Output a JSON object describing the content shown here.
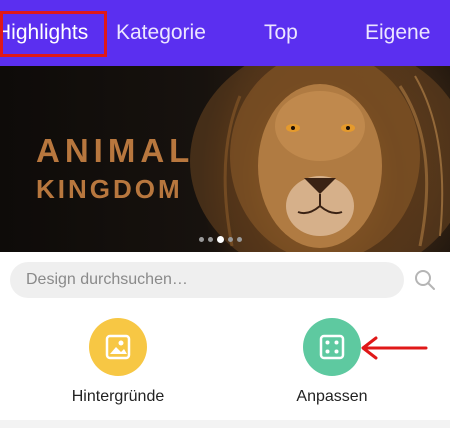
{
  "tabs": [
    {
      "label": "Highlights"
    },
    {
      "label": "Kategorie"
    },
    {
      "label": "Top"
    },
    {
      "label": "Eigene"
    }
  ],
  "banner": {
    "title_line1": "ANIMAL",
    "title_line2": "KINGDOM",
    "pager": {
      "count": 5,
      "active_index": 2
    }
  },
  "search": {
    "placeholder": "Design durchsuchen…"
  },
  "categories": [
    {
      "label": "Hintergründe",
      "icon": "image-icon",
      "color": "#f7c744"
    },
    {
      "label": "Anpassen",
      "icon": "dice-icon",
      "color": "#5ec9a0"
    }
  ],
  "colors": {
    "tabbar": "#5b2ff0",
    "annotation": "#e01818"
  }
}
